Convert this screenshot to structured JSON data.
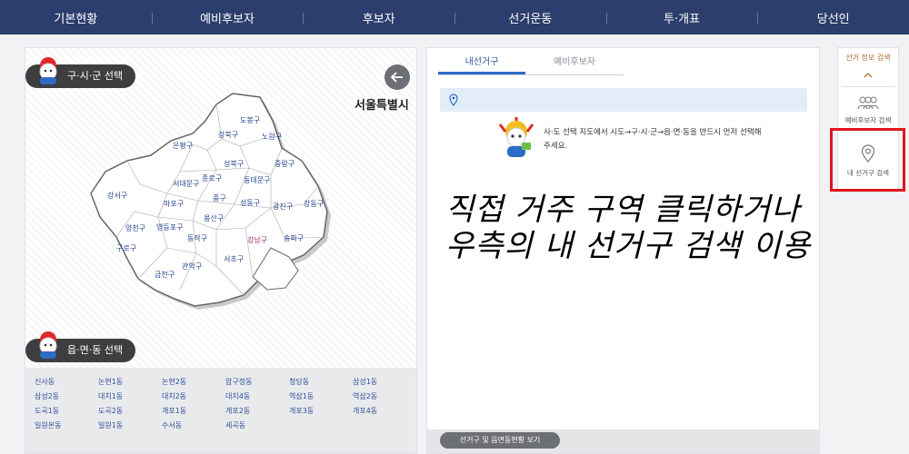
{
  "nav": [
    "기본현황",
    "예비후보자",
    "후보자",
    "선거운동",
    "투·개표",
    "당선인"
  ],
  "map_panel": {
    "select_pill": "구·시·군 선택",
    "city": "서울특별시",
    "districts": [
      {
        "name": "도봉구"
      },
      {
        "name": "강북구"
      },
      {
        "name": "노원구"
      },
      {
        "name": "은평구"
      },
      {
        "name": "성북구"
      },
      {
        "name": "중랑구"
      },
      {
        "name": "종로구"
      },
      {
        "name": "동대문구"
      },
      {
        "name": "서대문구"
      },
      {
        "name": "강서구"
      },
      {
        "name": "마포구"
      },
      {
        "name": "중구"
      },
      {
        "name": "성동구"
      },
      {
        "name": "광진구"
      },
      {
        "name": "강동구"
      },
      {
        "name": "용산구"
      },
      {
        "name": "양천구"
      },
      {
        "name": "영등포구"
      },
      {
        "name": "동작구"
      },
      {
        "name": "강남구",
        "selected": true
      },
      {
        "name": "송파구"
      },
      {
        "name": "구로구"
      },
      {
        "name": "관악구"
      },
      {
        "name": "서초구"
      },
      {
        "name": "금천구"
      }
    ],
    "dong_pill": "읍·면·동 선택",
    "dongs": [
      "신사동",
      "논현1동",
      "논현2동",
      "압구정동",
      "청담동",
      "삼성1동",
      "삼성2동",
      "대치1동",
      "대치2동",
      "대치4동",
      "역삼1동",
      "역삼2동",
      "도곡1동",
      "도곡2동",
      "개포1동",
      "개포2동",
      "개포3동",
      "개포4동",
      "일원본동",
      "일원1동",
      "수서동",
      "세곡동"
    ]
  },
  "mid_panel": {
    "tabs": [
      "내선거구",
      "예비후보자"
    ],
    "description": "사·도 선택 지도에서 시도→구·시·군→읍·면·동을 반드시 먼저 선택해 주세요.",
    "overlay_line1": "직접 거주 구역 클릭하거나",
    "overlay_line2": "우측의 내 선거구 검색 이용",
    "bottom_button": "선거구 및 읍면동현황 보기"
  },
  "side": {
    "title": "선거 정보 검색",
    "btn1": "예비후보자 검색",
    "btn2": "내 선거구 검색"
  },
  "colors": {
    "nav": "#2c3e6d",
    "highlight": "#e0141b",
    "district_text": "#1f3f8a",
    "selected_district_text": "#a0287a"
  }
}
